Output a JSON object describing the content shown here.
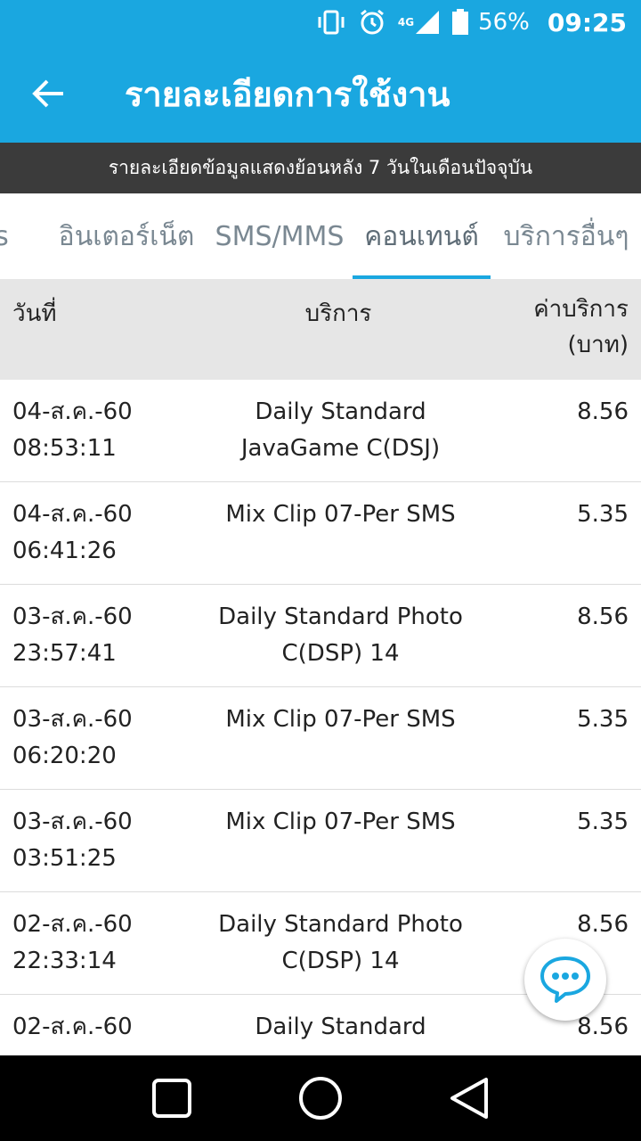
{
  "status_bar": {
    "network": "4G",
    "battery": "56%",
    "time": "09:25",
    "icons": [
      "vibrate-icon",
      "alarm-icon",
      "signal-icon",
      "battery-icon"
    ]
  },
  "app_bar": {
    "title": "รายละเอียดการใช้งาน",
    "back_icon": "arrow-left-icon"
  },
  "banner": {
    "text": "รายละเอียดข้อมูลแสดงย้อนหลัง 7 วันในเดือนปัจจุบัน"
  },
  "tabs": [
    {
      "label": "s",
      "active": false
    },
    {
      "label": "อินเตอร์เน็ต",
      "active": false
    },
    {
      "label": "SMS/MMS",
      "active": false
    },
    {
      "label": "คอนเทนต์",
      "active": true
    },
    {
      "label": "บริการอื่นๆ",
      "active": false
    }
  ],
  "table": {
    "headers": {
      "date": "วันที่",
      "service": "บริการ",
      "price_line1": "ค่าบริการ",
      "price_line2": "(บาท)"
    },
    "rows": [
      {
        "date": "04-ส.ค.-60",
        "time": "08:53:11",
        "service1": "Daily Standard",
        "service2": "JavaGame C(DSJ)",
        "price": "8.56"
      },
      {
        "date": "04-ส.ค.-60",
        "time": "06:41:26",
        "service1": "Mix Clip 07-Per SMS",
        "service2": "",
        "price": "5.35"
      },
      {
        "date": "03-ส.ค.-60",
        "time": "23:57:41",
        "service1": "Daily Standard Photo",
        "service2": "C(DSP) 14",
        "price": "8.56"
      },
      {
        "date": "03-ส.ค.-60",
        "time": "06:20:20",
        "service1": "Mix Clip 07-Per SMS",
        "service2": "",
        "price": "5.35"
      },
      {
        "date": "03-ส.ค.-60",
        "time": "03:51:25",
        "service1": "Mix Clip 07-Per SMS",
        "service2": "",
        "price": "5.35"
      },
      {
        "date": "02-ส.ค.-60",
        "time": "22:33:14",
        "service1": "Daily Standard Photo",
        "service2": "C(DSP) 14",
        "price": "8.56"
      },
      {
        "date": "02-ส.ค.-60",
        "time": "",
        "service1": "Daily Standard",
        "service2": "",
        "price": "8.56"
      }
    ]
  },
  "chat_fab": {
    "icon": "chat-bubble-icon"
  },
  "nav_bar": {
    "icons": [
      "recents-square-icon",
      "home-circle-icon",
      "back-triangle-icon"
    ]
  },
  "colors": {
    "primary": "#1aa7e0",
    "banner": "#3b3b3b",
    "header_bg": "#e6e6e6"
  }
}
